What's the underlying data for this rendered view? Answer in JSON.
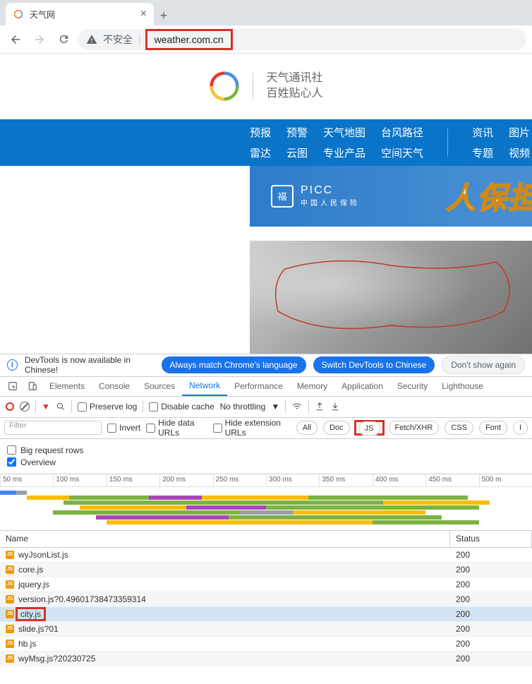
{
  "browser": {
    "tab_title": "天气网",
    "security_label": "不安全",
    "url": "weather.com.cn"
  },
  "page": {
    "logo_line1": "天气通讯社",
    "logo_line2": "百姓贴心人",
    "nav": {
      "c1a": "预报",
      "c1b": "雷达",
      "c2a": "预警",
      "c2b": "云图",
      "c3a": "天气地图",
      "c3b": "专业产品",
      "c4a": "台风路径",
      "c4b": "空间天气",
      "c5a": "资讯",
      "c5b": "专题",
      "c6a": "图片",
      "c6b": "视频"
    },
    "banner": {
      "picc_en": "PICC",
      "picc_cn": "中国人民保险",
      "text": "人保担"
    }
  },
  "devtools": {
    "banner_text": "DevTools is now available in Chinese!",
    "btn_always": "Always match Chrome's language",
    "btn_switch": "Switch DevTools to Chinese",
    "btn_dont": "Don't show again",
    "tabs": {
      "elements": "Elements",
      "console": "Console",
      "sources": "Sources",
      "network": "Network",
      "performance": "Performance",
      "memory": "Memory",
      "application": "Application",
      "security": "Security",
      "lighthouse": "Lighthouse"
    },
    "toolbar": {
      "preserve": "Preserve log",
      "disable": "Disable cache",
      "throttling": "No throttling"
    },
    "filter": {
      "placeholder": "Filter",
      "invert": "Invert",
      "hide_data": "Hide data URLs",
      "hide_ext": "Hide extension URLs",
      "all": "All",
      "doc": "Doc",
      "js": "JS",
      "fetch": "Fetch/XHR",
      "css": "CSS",
      "font": "Font",
      "img": "I"
    },
    "opts": {
      "big": "Big request rows",
      "overview": "Overview"
    },
    "timeline": {
      "ticks": [
        "50 ms",
        "100 ms",
        "150 ms",
        "200 ms",
        "250 ms",
        "300 ms",
        "350 ms",
        "400 ms",
        "450 ms",
        "500 m"
      ]
    },
    "table": {
      "hdr_name": "Name",
      "hdr_status": "Status",
      "rows": [
        {
          "name": "wyJsonList.js",
          "status": "200",
          "sel": false
        },
        {
          "name": "core.js",
          "status": "200",
          "sel": false
        },
        {
          "name": "jquery.js",
          "status": "200",
          "sel": false
        },
        {
          "name": "version.js?0.49601738473359314",
          "status": "200",
          "sel": false
        },
        {
          "name": "city.js",
          "status": "200",
          "sel": true,
          "hl": true
        },
        {
          "name": "slide.js?01",
          "status": "200",
          "sel": false
        },
        {
          "name": "hb.js",
          "status": "200",
          "sel": false
        },
        {
          "name": "wyMsg.js?20230725",
          "status": "200",
          "sel": false
        }
      ]
    }
  }
}
